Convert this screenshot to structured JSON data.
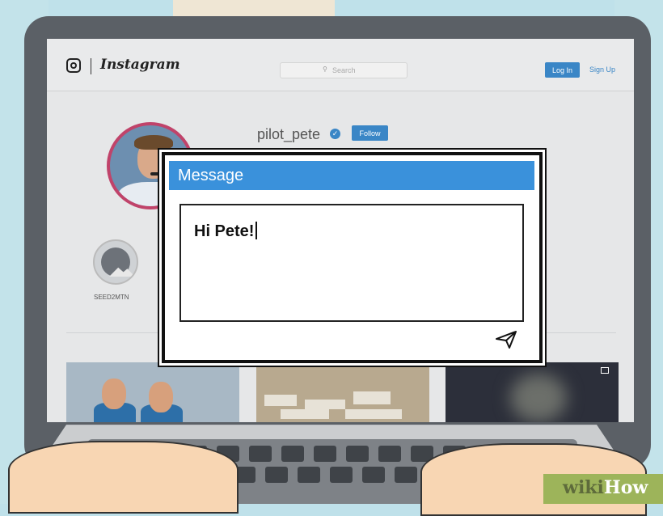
{
  "instagram": {
    "wordmark": "Instagram",
    "search_placeholder": "Search",
    "login_label": "Log In",
    "signup_label": "Sign Up"
  },
  "profile": {
    "username": "pilot_pete",
    "follow_label": "Follow",
    "highlights": [
      {
        "label": "SEED2MTN"
      }
    ]
  },
  "message_dialog": {
    "title": "Message",
    "text": "Hi Pete!"
  },
  "watermark": {
    "prefix": "wiki",
    "suffix": "How"
  },
  "colors": {
    "instagram_blue": "#3a86c6",
    "dialog_titlebar": "#3a91db",
    "avatar_ring": "#c0436a"
  },
  "icons": [
    "instagram-logo-icon",
    "search-icon",
    "verified-badge-icon",
    "send-icon",
    "multi-photo-icon"
  ]
}
